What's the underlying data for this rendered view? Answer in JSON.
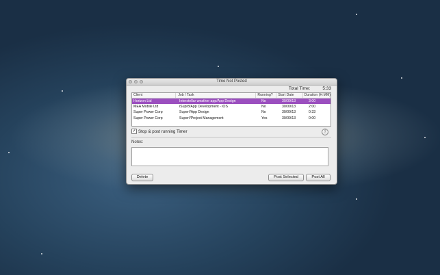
{
  "window": {
    "title": "Time Not Posted"
  },
  "total": {
    "label": "Total Time:",
    "value": "5:33"
  },
  "table": {
    "headers": [
      "Client",
      "Job / Task",
      "Running?",
      "Start Date",
      "Duration (H:MM)"
    ],
    "rows": [
      [
        "Horizon Ltd",
        "Interstellar weather app/App Design",
        "No",
        "30/09/13",
        "3:00"
      ],
      [
        "MEA Mobile Ltd",
        "iSupr8/App Development - iOS",
        "No",
        "30/09/13",
        "2:00"
      ],
      [
        "Super Power Corp",
        "Super!/App Design",
        "No",
        "30/09/13",
        "0:33"
      ],
      [
        "Super Power Corp",
        "Super!/Project Management",
        "Yes",
        "30/09/13",
        "0:00"
      ]
    ],
    "selected_row": 0,
    "selected_color": "#9b4fbf"
  },
  "stop_post": {
    "label": "Stop & post running Timer",
    "checked": true
  },
  "help": {
    "label": "?"
  },
  "notes": {
    "label": "Notes:",
    "value": ""
  },
  "buttons": {
    "delete": "Delete",
    "post_selected": "Post Selected",
    "post_all": "Post All"
  }
}
